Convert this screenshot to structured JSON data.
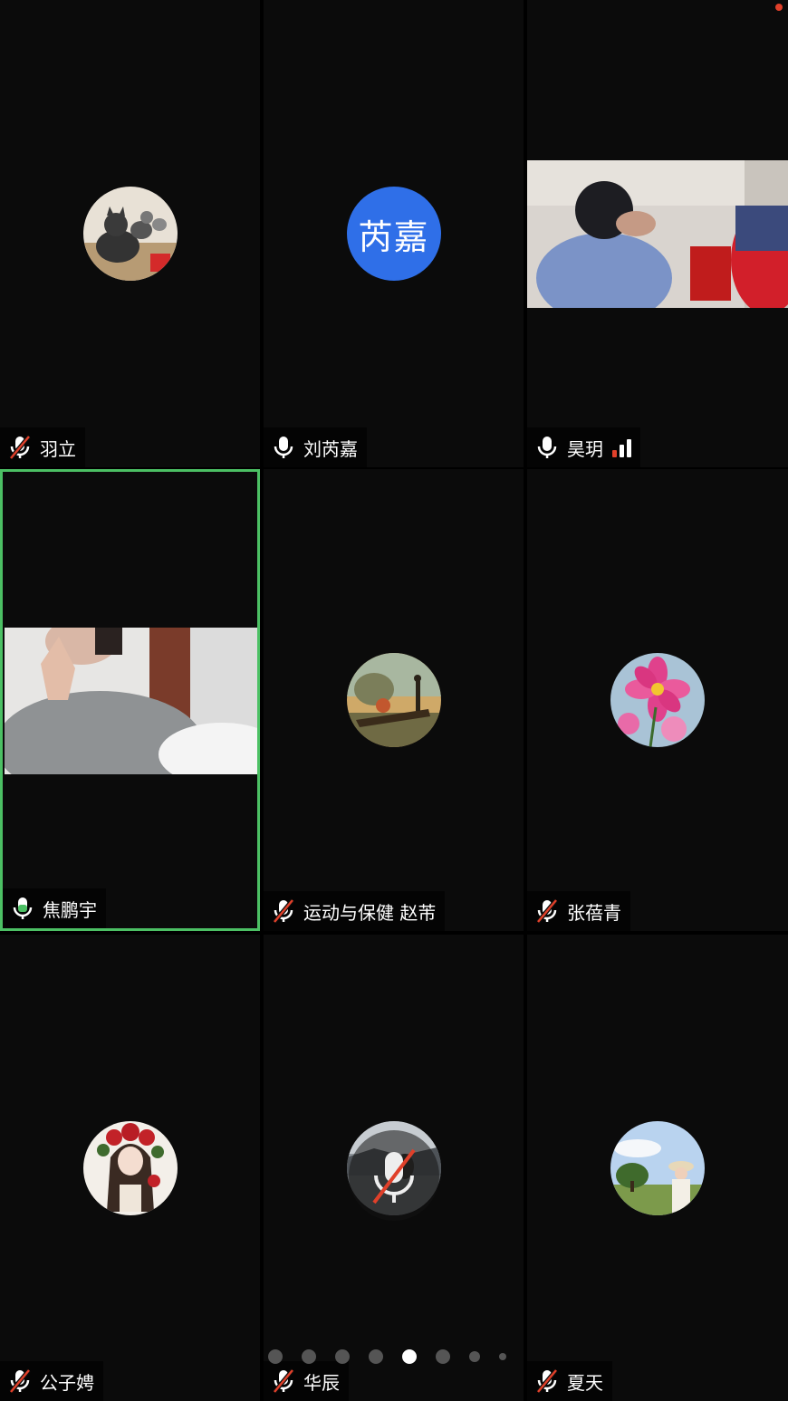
{
  "participants": [
    {
      "name": "羽立",
      "muted": true
    },
    {
      "name": "刘芮嘉",
      "muted": false,
      "avatar_text": "芮嘉",
      "avatar_color": "#2f6fe8"
    },
    {
      "name": "昊玥",
      "muted": false
    },
    {
      "name": "焦鹏宇",
      "muted": false,
      "speaking": true
    },
    {
      "name": "运动与保健 赵芾",
      "muted": true
    },
    {
      "name": "张蓓青",
      "muted": true
    },
    {
      "name": "公子娉",
      "muted": true
    },
    {
      "name": "华辰",
      "muted": true
    },
    {
      "name": "夏天",
      "muted": true
    }
  ],
  "pagination": {
    "total_pages": 8,
    "current_page": 5
  },
  "colors": {
    "active_border": "#4cc064",
    "muted_slash": "#e0402a",
    "background": "#0b0b0b"
  }
}
